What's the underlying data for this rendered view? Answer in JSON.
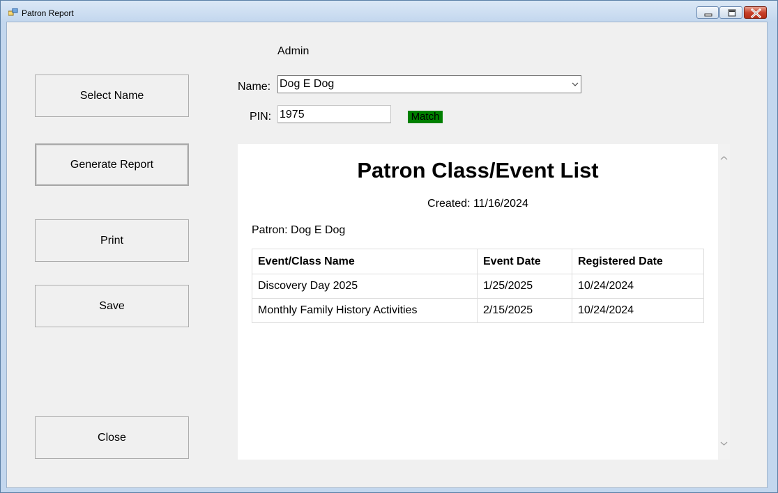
{
  "window": {
    "title": "Patron Report"
  },
  "sidebar": {
    "select_name_label": "Select Name",
    "generate_report_label": "Generate Report",
    "print_label": "Print",
    "save_label": "Save",
    "close_label": "Close"
  },
  "form": {
    "user_role": "Admin",
    "name_label": "Name:",
    "name_value": "Dog E Dog",
    "pin_label": "PIN:",
    "pin_value": "1975",
    "match_status": "Match",
    "match_color": "#008000"
  },
  "report": {
    "title": "Patron Class/Event List",
    "created": "Created: 11/16/2024",
    "patron": "Patron: Dog E Dog",
    "columns": [
      "Event/Class Name",
      "Event Date",
      "Registered Date"
    ],
    "rows": [
      [
        "Discovery Day 2025",
        "1/25/2025",
        "10/24/2024"
      ],
      [
        "Monthly Family History Activities",
        "2/15/2025",
        "10/24/2024"
      ]
    ]
  },
  "icons": {
    "app": "app-window-icon",
    "minimize": "minimize-icon",
    "maximize": "maximize-icon",
    "close": "close-icon",
    "dropdown": "chevron-down-icon",
    "scroll_up": "chevron-up-icon",
    "scroll_down": "chevron-down-icon"
  }
}
